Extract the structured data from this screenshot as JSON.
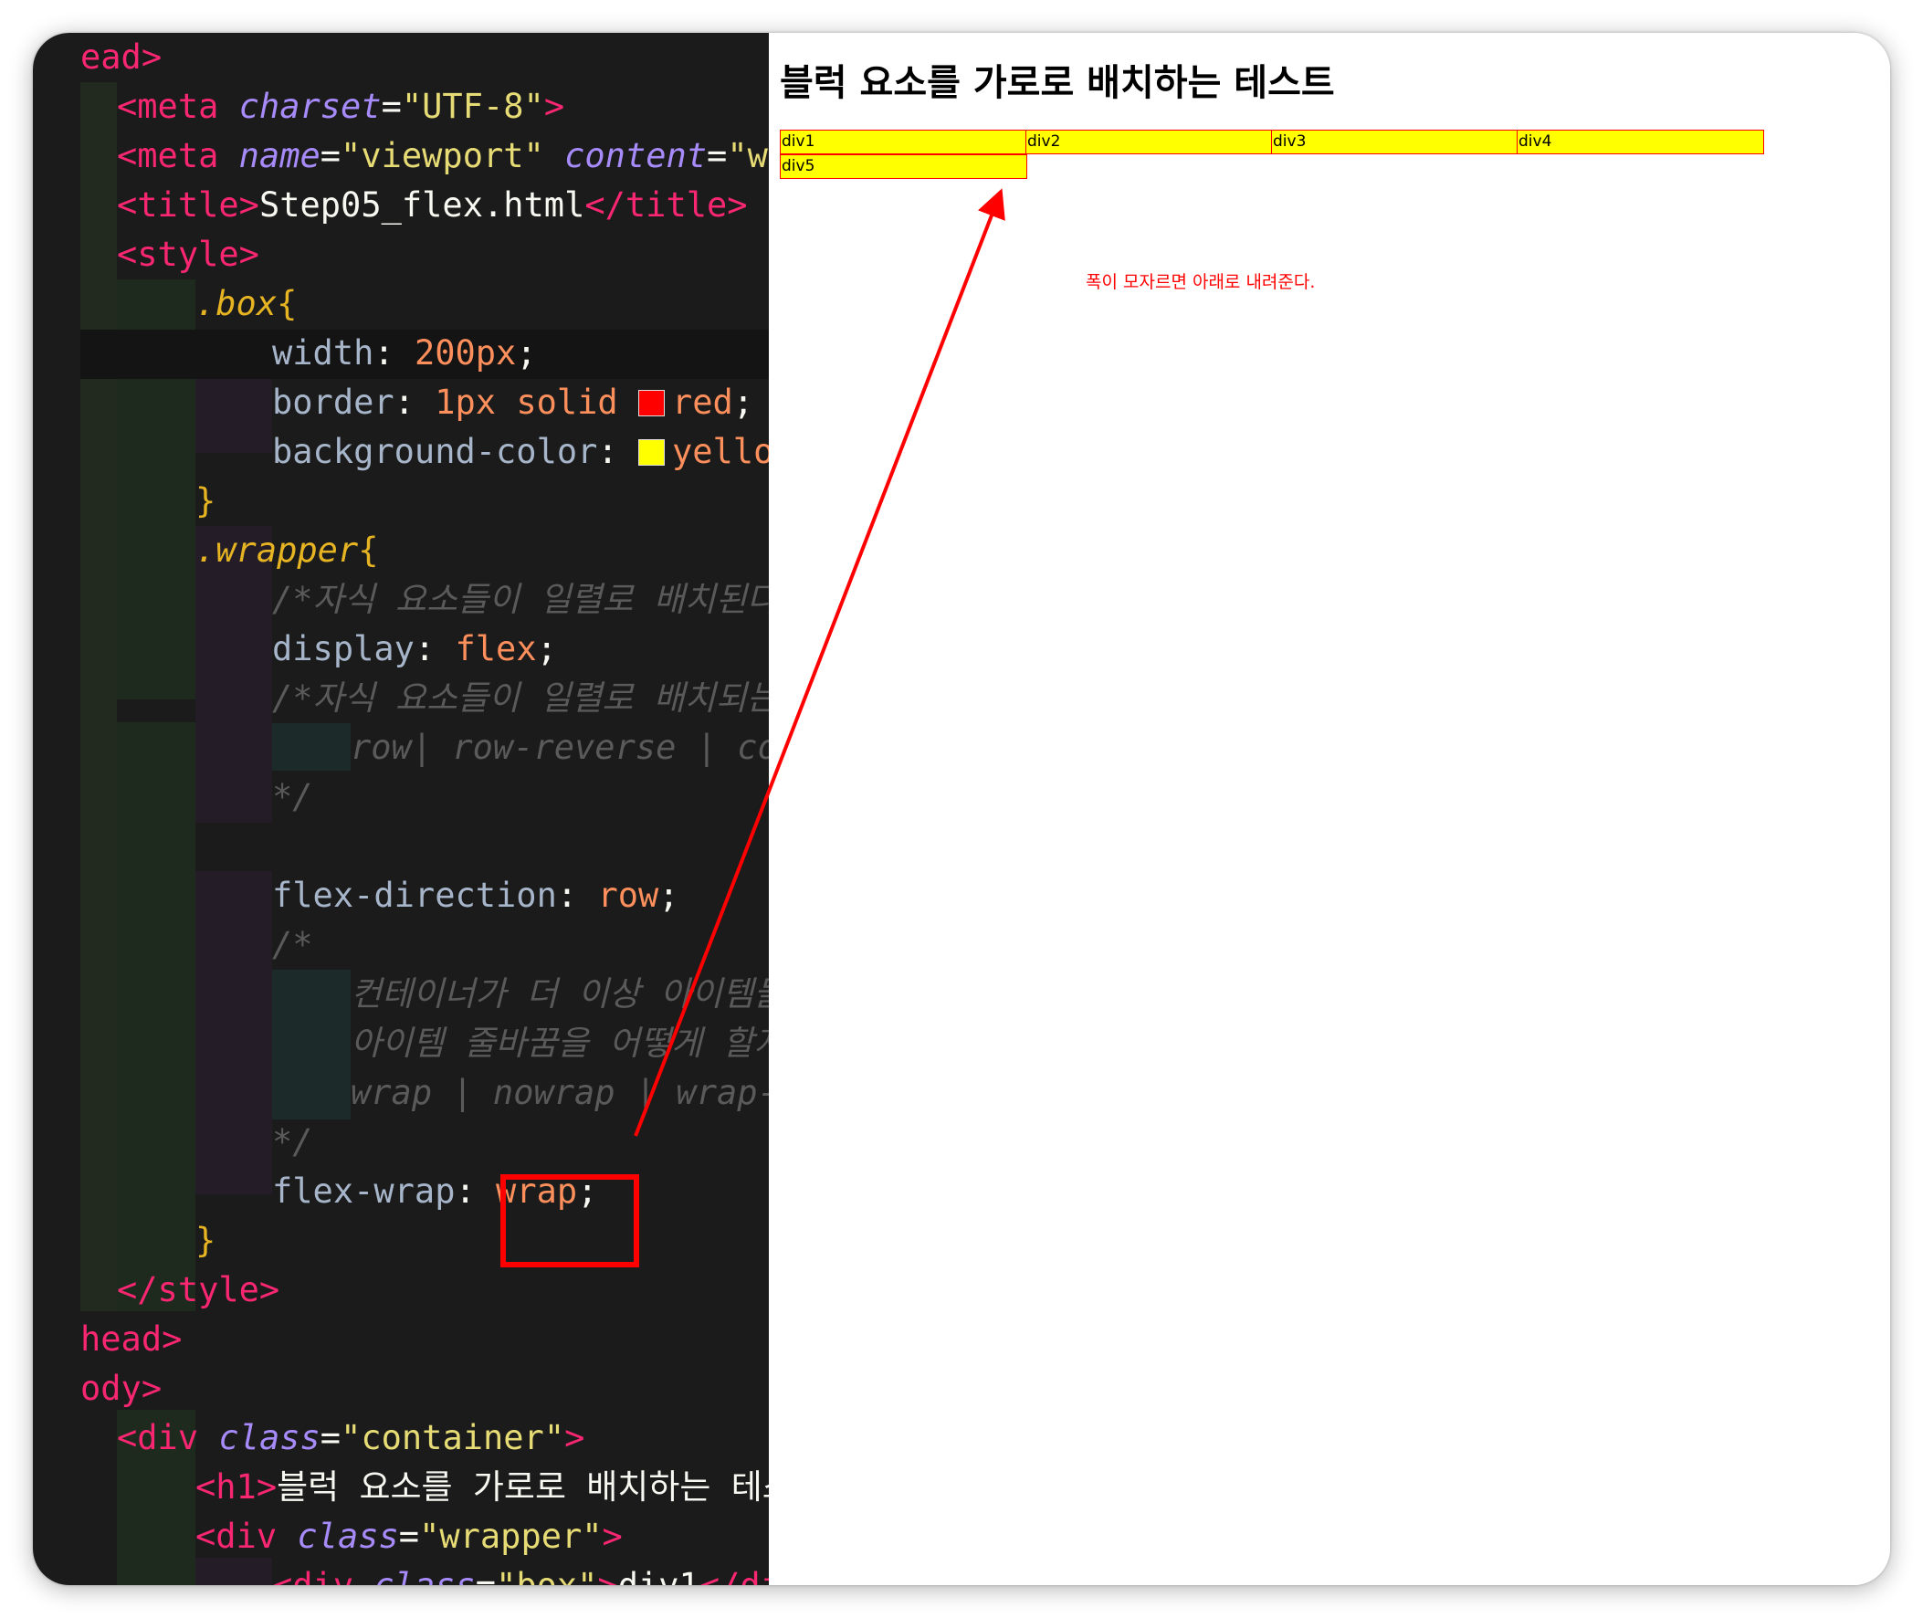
{
  "editor": {
    "lines": [
      [
        {
          "t": "ead>",
          "c": "tag"
        }
      ],
      [
        {
          "t": "<meta ",
          "c": "tag"
        },
        {
          "t": "charset",
          "c": "attr"
        },
        {
          "t": "=",
          "c": "punc"
        },
        {
          "t": "\"UTF-8\"",
          "c": "str"
        },
        {
          "t": ">",
          "c": "tag"
        }
      ],
      [
        {
          "t": "<meta ",
          "c": "tag"
        },
        {
          "t": "name",
          "c": "attr"
        },
        {
          "t": "=",
          "c": "punc"
        },
        {
          "t": "\"viewport\" ",
          "c": "str"
        },
        {
          "t": "content",
          "c": "attr"
        },
        {
          "t": "=",
          "c": "punc"
        },
        {
          "t": "\"wi",
          "c": "str"
        }
      ],
      [
        {
          "t": "<title>",
          "c": "tag"
        },
        {
          "t": "Step05_flex.html",
          "c": "txt"
        },
        {
          "t": "</title>",
          "c": "tag"
        }
      ],
      [
        {
          "t": "<style>",
          "c": "tag"
        }
      ],
      [
        {
          "t": ".box",
          "c": "sel"
        },
        {
          "t": "{",
          "c": "brace"
        }
      ],
      [
        {
          "t": "width",
          "c": "prop"
        },
        {
          "t": ": ",
          "c": "punc"
        },
        {
          "t": "200px",
          "c": "val"
        },
        {
          "t": ";",
          "c": "punc"
        }
      ],
      [
        {
          "t": "border",
          "c": "prop"
        },
        {
          "t": ": ",
          "c": "punc"
        },
        {
          "t": "1px solid ",
          "c": "val"
        },
        {
          "t": "",
          "c": "swatch",
          "color": "#ff0000"
        },
        {
          "t": "red",
          "c": "val"
        },
        {
          "t": ";",
          "c": "punc"
        }
      ],
      [
        {
          "t": "background-color",
          "c": "prop"
        },
        {
          "t": ": ",
          "c": "punc"
        },
        {
          "t": "",
          "c": "swatch",
          "color": "#ffff00"
        },
        {
          "t": "yello",
          "c": "val"
        }
      ],
      [
        {
          "t": "}",
          "c": "brace"
        }
      ],
      [
        {
          "t": ".wrapper",
          "c": "sel"
        },
        {
          "t": "{",
          "c": "brace"
        }
      ],
      [
        {
          "t": "/*자식 요소들이 일렬로 배치된다*/",
          "c": "cmt"
        }
      ],
      [
        {
          "t": "display",
          "c": "prop"
        },
        {
          "t": ": ",
          "c": "punc"
        },
        {
          "t": "flex",
          "c": "val"
        },
        {
          "t": ";",
          "c": "punc"
        }
      ],
      [
        {
          "t": "/*자식 요소들이 일렬로 배치되는 ",
          "c": "cmt"
        }
      ],
      [
        {
          "t": "row| row-reverse | co",
          "c": "cmt"
        }
      ],
      [
        {
          "t": "*/",
          "c": "cmt"
        }
      ],
      [],
      [
        {
          "t": "flex-direction",
          "c": "prop"
        },
        {
          "t": ": ",
          "c": "punc"
        },
        {
          "t": "row",
          "c": "val"
        },
        {
          "t": ";",
          "c": "punc"
        }
      ],
      [
        {
          "t": "/*",
          "c": "cmt"
        }
      ],
      [
        {
          "t": "컨테이너가 더 이상 아이템들을",
          "c": "cmt"
        }
      ],
      [
        {
          "t": "아이템 줄바꿈을 어떻게 할지 ",
          "c": "cmt"
        }
      ],
      [
        {
          "t": "wrap | nowrap | wrap-",
          "c": "cmt"
        }
      ],
      [
        {
          "t": "*/",
          "c": "cmt"
        }
      ],
      [
        {
          "t": "flex-wrap",
          "c": "prop"
        },
        {
          "t": ": ",
          "c": "punc"
        },
        {
          "t": "wrap",
          "c": "val"
        },
        {
          "t": ";",
          "c": "punc"
        }
      ],
      [
        {
          "t": "}",
          "c": "brace"
        }
      ],
      [
        {
          "t": "</style>",
          "c": "tag"
        }
      ],
      [
        {
          "t": "head>",
          "c": "tag"
        }
      ],
      [
        {
          "t": "ody>",
          "c": "tag"
        }
      ],
      [
        {
          "t": "<div ",
          "c": "tag"
        },
        {
          "t": "class",
          "c": "attr"
        },
        {
          "t": "=",
          "c": "punc"
        },
        {
          "t": "\"container\"",
          "c": "str"
        },
        {
          "t": ">",
          "c": "tag"
        }
      ],
      [
        {
          "t": "<h1>",
          "c": "tag"
        },
        {
          "t": "블럭 요소를 가로로 배치하는 테스트",
          "c": "txt"
        }
      ],
      [
        {
          "t": "<div ",
          "c": "tag"
        },
        {
          "t": "class",
          "c": "attr"
        },
        {
          "t": "=",
          "c": "punc"
        },
        {
          "t": "\"wrapper\"",
          "c": "str"
        },
        {
          "t": ">",
          "c": "tag"
        }
      ],
      [
        {
          "t": "<div ",
          "c": "tag"
        },
        {
          "t": "class",
          "c": "attr"
        },
        {
          "t": "=",
          "c": "punc"
        },
        {
          "t": "\"box\"",
          "c": "str"
        },
        {
          "t": ">",
          "c": "tag"
        },
        {
          "t": "div1",
          "c": "txt"
        },
        {
          "t": "</di",
          "c": "tag"
        }
      ]
    ]
  },
  "preview": {
    "title": "블럭 요소를 가로로 배치하는 테스트",
    "boxes": [
      "div1",
      "div2",
      "div3",
      "div4",
      "div5"
    ]
  },
  "annotation": {
    "note": "폭이 모자르면 아래로 내려준다.",
    "color": "#ff0000"
  }
}
